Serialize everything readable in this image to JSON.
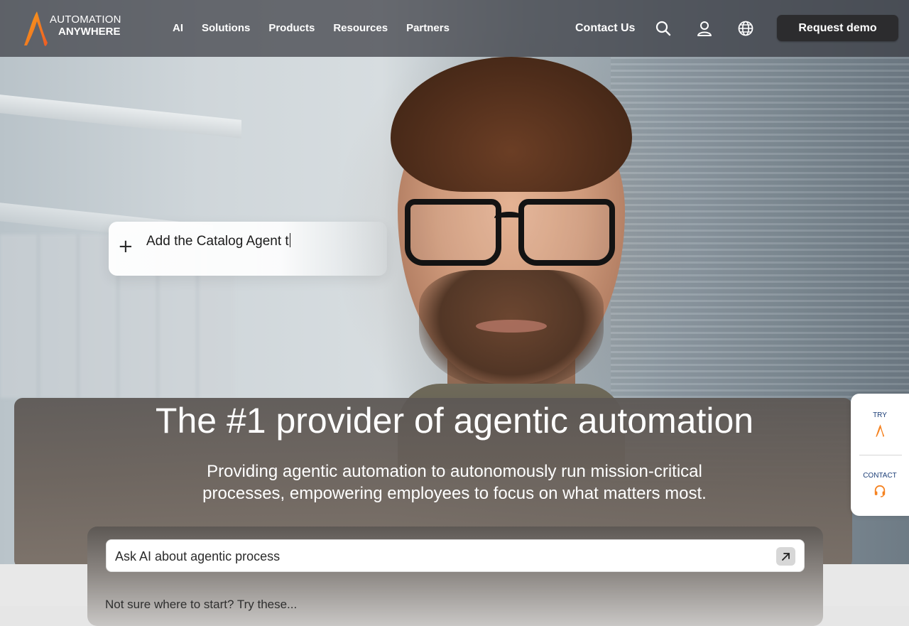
{
  "brand": {
    "line1": "AUTOMATION",
    "line2": "ANYWHERE"
  },
  "nav": {
    "links": [
      "AI",
      "Solutions",
      "Products",
      "Resources",
      "Partners"
    ],
    "contact": "Contact Us",
    "icons": [
      "search-icon",
      "user-icon",
      "globe-icon"
    ],
    "cta": "Request demo"
  },
  "prompt": {
    "text": "Add the Catalog Agent t"
  },
  "hero": {
    "title": "The #1 provider of agentic automation",
    "subtitle_line1": "Providing agentic automation to autonomously run mission-critical",
    "subtitle_line2": "processes, empowering employees to focus on what matters most."
  },
  "ask": {
    "input_text": "Ask AI about agentic process",
    "helper_text": "Not sure where to start? Try these..."
  },
  "side_widget": {
    "try_label": "TRY",
    "contact_label": "CONTACT"
  },
  "colors": {
    "brand_orange": "#f58220",
    "navy": "#1c3e77",
    "cta_bg": "#2c2c2e"
  }
}
